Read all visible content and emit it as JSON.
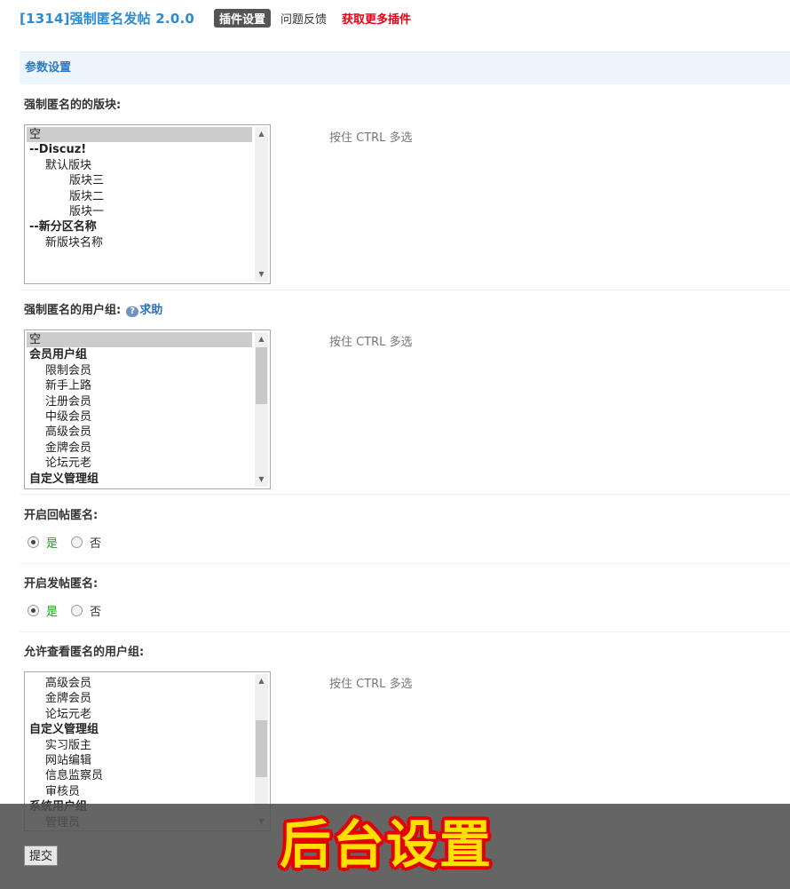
{
  "header": {
    "title": "[1314]强制匿名发帖 2.0.0",
    "tabs": [
      "插件设置",
      "问题反馈",
      "获取更多插件"
    ]
  },
  "section_title": "参数设置",
  "forums": {
    "label": "强制匿名的的版块:",
    "hint": "按住 CTRL 多选",
    "options": [
      {
        "text": "空",
        "selected": true
      },
      {
        "text": "--Discuz!",
        "group": true
      },
      {
        "text": "默认版块"
      },
      {
        "text": "版块三"
      },
      {
        "text": "版块二"
      },
      {
        "text": "版块一"
      },
      {
        "text": "--新分区名称",
        "group": true
      },
      {
        "text": "新版块名称"
      }
    ]
  },
  "usergroups": {
    "label": "强制匿名的用户组:",
    "help": "求助",
    "hint": "按住 CTRL 多选",
    "options": [
      {
        "text": "空",
        "selected": true
      },
      {
        "text": "会员用户组",
        "group": true
      },
      {
        "text": "限制会员"
      },
      {
        "text": "新手上路"
      },
      {
        "text": "注册会员"
      },
      {
        "text": "中级会员"
      },
      {
        "text": "高级会员"
      },
      {
        "text": "金牌会员"
      },
      {
        "text": "论坛元老"
      },
      {
        "text": "自定义管理组",
        "group": true
      }
    ]
  },
  "reply_anon": {
    "label": "开启回帖匿名:",
    "yes": "是",
    "no": "否",
    "value": "yes"
  },
  "post_anon": {
    "label": "开启发帖匿名:",
    "yes": "是",
    "no": "否",
    "value": "yes"
  },
  "view_groups": {
    "label": "允许查看匿名的用户组:",
    "hint": "按住 CTRL 多选",
    "options": [
      {
        "text": "高级会员"
      },
      {
        "text": "金牌会员"
      },
      {
        "text": "论坛元老"
      },
      {
        "text": "自定义管理组",
        "group": true
      },
      {
        "text": "实习版主"
      },
      {
        "text": "网站编辑"
      },
      {
        "text": "信息监察员"
      },
      {
        "text": "审核员"
      },
      {
        "text": "系统用户组",
        "group": true
      },
      {
        "text": "管理员"
      }
    ]
  },
  "submit_label": "提交",
  "banner_text": "后台设置"
}
